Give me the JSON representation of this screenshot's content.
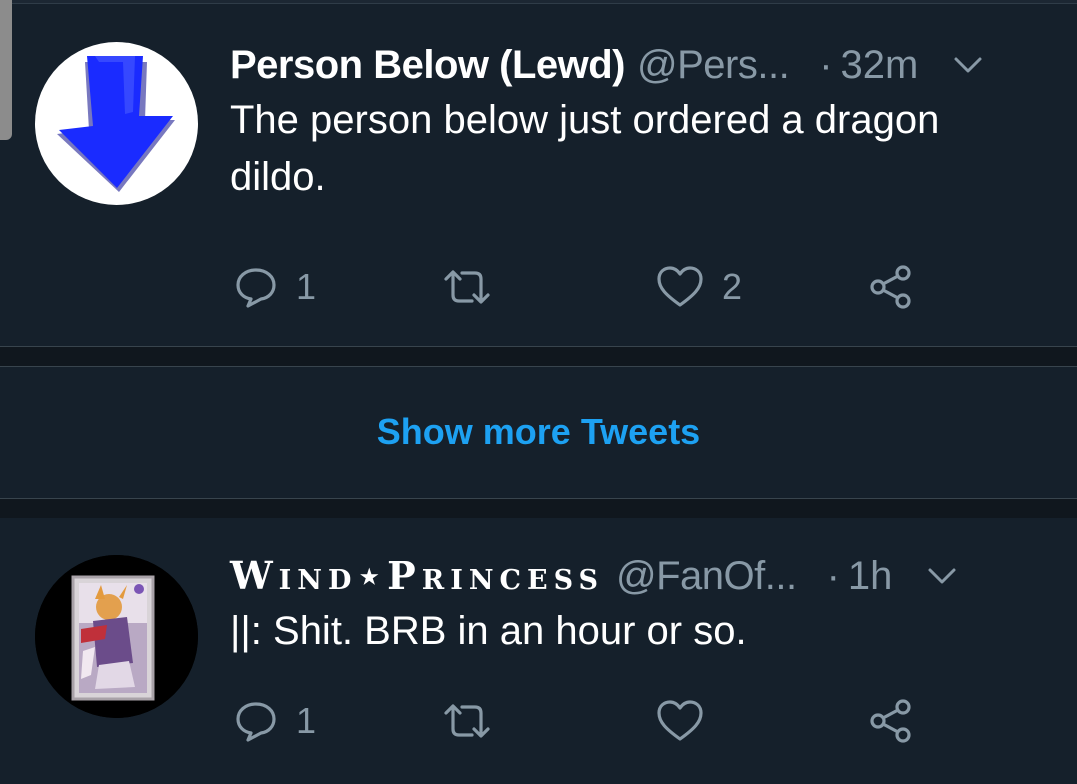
{
  "tweets": [
    {
      "display_name": "Person Below (Lewd)",
      "handle": "@Pers...",
      "dot": "·",
      "time": "32m",
      "text": "The person below just ordered a dragon dildo.",
      "reply_count": "1",
      "retweet_count": "",
      "like_count": "2",
      "avatar_icon": "blue-down-arrow-icon"
    },
    {
      "display_name": "Wind⋆Princess",
      "handle": "@FanOf...",
      "dot": "·",
      "time": "1h",
      "text": "||: Shit. BRB in an hour or so.",
      "reply_count": "1",
      "retweet_count": "",
      "like_count": "",
      "avatar_icon": "anime-card-icon"
    }
  ],
  "show_more": {
    "label": "Show more Tweets"
  },
  "icons": {
    "reply": "reply-icon",
    "retweet": "retweet-icon",
    "like": "heart-icon",
    "share": "share-icon",
    "caret": "chevron-down-icon"
  },
  "colors": {
    "background": "#15202b",
    "accent": "#1da1f2",
    "secondary_text": "#8899a6",
    "arrow": "#1a1aff"
  }
}
